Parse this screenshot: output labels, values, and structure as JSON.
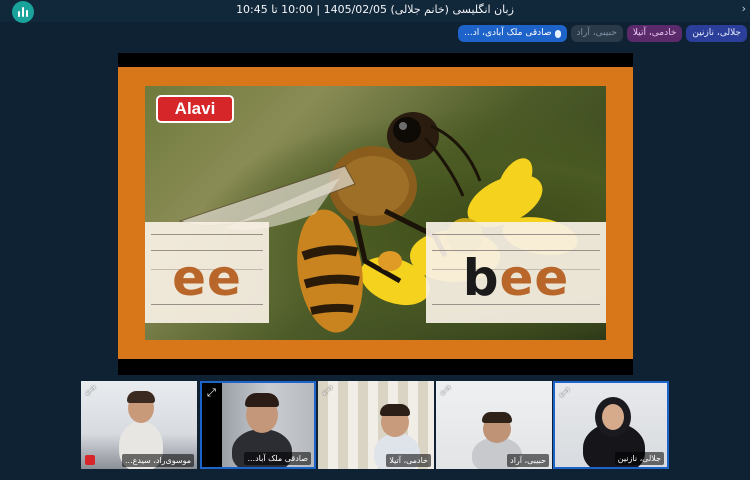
{
  "header": {
    "meeting_title": "زبان انگلیسی (خانم جلالی) 1405/02/05 | 10:00 تا 10:45",
    "app_icon": "audio-bars-icon",
    "edge_icon": "chevron-right-icon"
  },
  "participants_bar": {
    "chips": [
      {
        "name": "جلالی، نازنین",
        "state": "presenter"
      },
      {
        "name": "خادمی، آتیلا",
        "state": "active"
      },
      {
        "name": "حبیبی، آراد",
        "state": "inactive"
      },
      {
        "name": "صادقی ملک آبادی، اد...",
        "state": "speaking",
        "icon": "microphone-icon"
      }
    ]
  },
  "slide": {
    "brand": "Alavi",
    "left_word": "ee",
    "right_word": {
      "highlighted": "b",
      "rest": "ee"
    },
    "frame_color": "#d8771a"
  },
  "video_tiles": [
    {
      "label": "موسوی‌راد، سیدع...",
      "muted": true
    },
    {
      "label": "صادقی ملک آباد...",
      "active": true
    },
    {
      "label": "خادمی، آتیلا"
    },
    {
      "label": "حبیبی، آراد"
    },
    {
      "label": "جلالی، نازنین",
      "active": true
    }
  ],
  "colors": {
    "background": "#0f2233",
    "accent_blue": "#1e63c9",
    "brand_red": "#d6262a"
  }
}
